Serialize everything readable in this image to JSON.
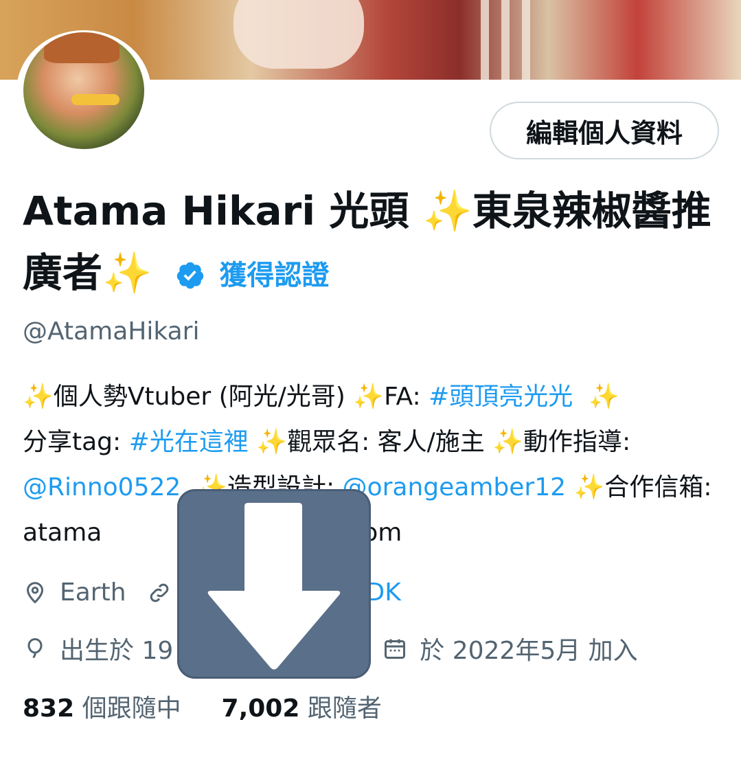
{
  "profile": {
    "edit_button": "編輯個人資料",
    "name_line1": "Atama Hikari 光頭 ",
    "name_spark1": "✨",
    "name_line1b": "東泉辣椒醬推",
    "name_line2": "廣者",
    "name_spark2": "✨",
    "verified_label": "獲得認證",
    "handle": "@AtamaHikari"
  },
  "bio": {
    "s1": "✨",
    "t1": "個人勢Vtuber (阿光/光哥) ",
    "s2": "✨",
    "t2": "FA: ",
    "tag1": "#頭頂亮光光",
    "s3": "✨",
    "t3": "分享tag: ",
    "tag2": "#光在這裡",
    "s4": "✨",
    "t4": "觀眾名: 客人/施主 ",
    "s5": "✨",
    "t5": "動作指導: ",
    "mention1": "@Rinno0522",
    "s6": "✨",
    "t6": "造型設計: ",
    "mention2": "@orangeamber12",
    "s7": "✨",
    "t7": "合作信箱: atama",
    "t7b": "mail.com"
  },
  "meta": {
    "location": "Earth",
    "website_visible": "DK",
    "birth": "出生於 19",
    "joined": "於 2022年5月 加入"
  },
  "stats": {
    "following_count": "832",
    "following_label": "個跟隨中",
    "followers_count": "7,002",
    "followers_label": "跟隨者"
  },
  "overlay": {
    "icon": "download-arrow-icon",
    "color": "#5a6f89"
  },
  "colors": {
    "accent": "#1d9bf0",
    "text": "#0f1419",
    "secondary": "#536471"
  }
}
